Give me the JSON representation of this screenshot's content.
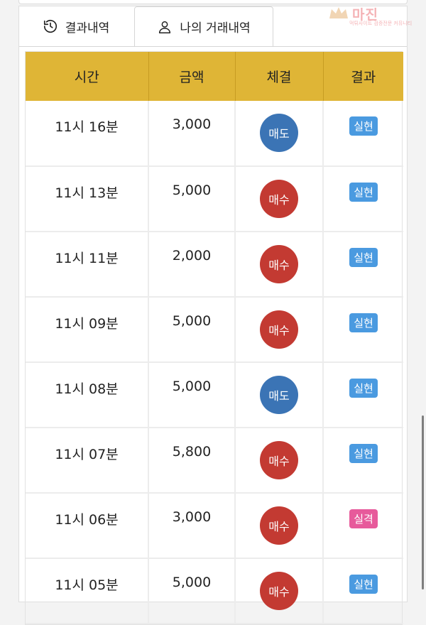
{
  "tabs": [
    {
      "label": "결과내역",
      "icon": "history-icon"
    },
    {
      "label": "나의 거래내역",
      "icon": "user-icon"
    }
  ],
  "table": {
    "columns": [
      "시간",
      "금액",
      "체결",
      "결과"
    ],
    "rows": [
      {
        "time": "11시 16분",
        "amount": "3,000",
        "exec": "매도",
        "exec_type": "sell",
        "result": "실현",
        "result_type": "win"
      },
      {
        "time": "11시 13분",
        "amount": "5,000",
        "exec": "매수",
        "exec_type": "buy",
        "result": "실현",
        "result_type": "win"
      },
      {
        "time": "11시 11분",
        "amount": "2,000",
        "exec": "매수",
        "exec_type": "buy",
        "result": "실현",
        "result_type": "win"
      },
      {
        "time": "11시 09분",
        "amount": "5,000",
        "exec": "매수",
        "exec_type": "buy",
        "result": "실현",
        "result_type": "win"
      },
      {
        "time": "11시 08분",
        "amount": "5,000",
        "exec": "매도",
        "exec_type": "sell",
        "result": "실현",
        "result_type": "win"
      },
      {
        "time": "11시 07분",
        "amount": "5,800",
        "exec": "매수",
        "exec_type": "buy",
        "result": "실현",
        "result_type": "win"
      },
      {
        "time": "11시 06분",
        "amount": "3,000",
        "exec": "매수",
        "exec_type": "buy",
        "result": "실격",
        "result_type": "loss"
      },
      {
        "time": "11시 05분",
        "amount": "5,000",
        "exec": "매수",
        "exec_type": "buy",
        "result": "실현",
        "result_type": "win"
      }
    ]
  },
  "watermark": {
    "text": "마진",
    "subtext": "먹튀사이트 검증전문 커뮤니티"
  },
  "colors": {
    "header": "#dfb536",
    "buy": "#c33a32",
    "sell": "#3b74b5",
    "win": "#4a9ae0",
    "loss": "#e75a9b"
  }
}
